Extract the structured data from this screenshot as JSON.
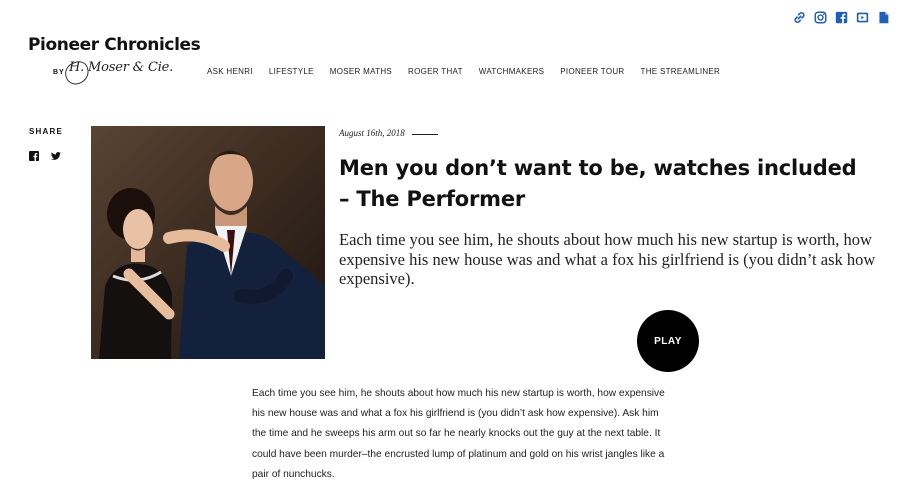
{
  "social_top": [
    {
      "name": "link-icon",
      "color": "#1f5fb8"
    },
    {
      "name": "instagram-icon",
      "color": "#1f5fb8"
    },
    {
      "name": "facebook-icon",
      "color": "#1f5fb8"
    },
    {
      "name": "youtube-icon",
      "color": "#1f5fb8"
    },
    {
      "name": "document-icon",
      "color": "#1f5fb8"
    }
  ],
  "brand": {
    "title": "Pioneer Chronicles",
    "by": "BY",
    "signature": "H. Moser & Cie."
  },
  "nav": {
    "items": [
      {
        "label": "ASK HENRI"
      },
      {
        "label": "LIFESTYLE"
      },
      {
        "label": "MOSER MATHS"
      },
      {
        "label": "ROGER THAT"
      },
      {
        "label": "WATCHMAKERS"
      },
      {
        "label": "PIONEER TOUR"
      },
      {
        "label": "THE STREAMLINER"
      }
    ]
  },
  "share": {
    "label": "SHARE",
    "icons": [
      "facebook-icon",
      "twitter-icon"
    ]
  },
  "article": {
    "date": "August 16th, 2018",
    "headline": "Men you don’t want to be, watches included – The Performer",
    "lede": "Each time you see him, he shouts about how much his new startup is worth, how expensive his new house was and what a fox his girlfriend is (you didn’t ask how expensive).",
    "play_label": "PLAY",
    "body": "Each time you see him, he shouts about how much his new startup is worth, how expensive his new house was and what a fox his girlfriend is (you didn’t ask how expensive). Ask him the time and he sweeps his arm out so far he nearly knocks out the guy at the next table. It could have been murder–the encrusted lump of platinum and gold on his wrist jangles like a pair of nunchucks."
  }
}
